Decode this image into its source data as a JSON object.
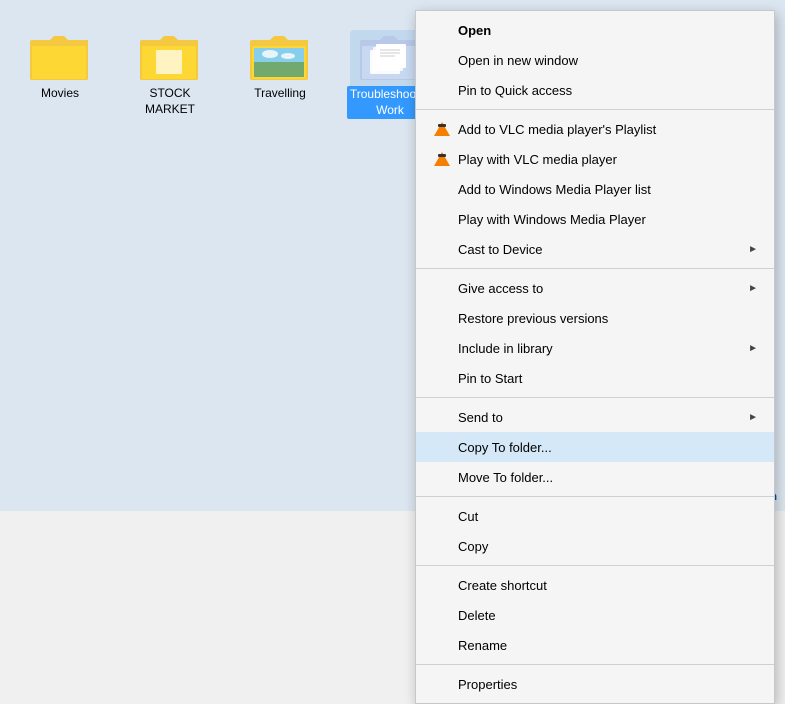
{
  "desktop": {
    "background": "#dce6f0"
  },
  "folders": [
    {
      "id": "movies",
      "label": "Movies",
      "selected": false
    },
    {
      "id": "stock-market",
      "label": "STOCK MARKET",
      "selected": false
    },
    {
      "id": "travelling",
      "label": "Travelling",
      "selected": false
    },
    {
      "id": "troubleshooter-work",
      "label": "Troubleshooter Work",
      "selected": true
    }
  ],
  "context_menu": {
    "items": [
      {
        "id": "open",
        "label": "Open",
        "bold": true,
        "icon": "",
        "submenu": false,
        "separator_after": false
      },
      {
        "id": "open-new-window",
        "label": "Open in new window",
        "bold": false,
        "icon": "",
        "submenu": false,
        "separator_after": false
      },
      {
        "id": "pin-quick-access",
        "label": "Pin to Quick access",
        "bold": false,
        "icon": "",
        "submenu": false,
        "separator_after": false
      },
      {
        "id": "add-vlc-playlist",
        "label": "Add to VLC media player's Playlist",
        "bold": false,
        "icon": "vlc",
        "submenu": false,
        "separator_after": false
      },
      {
        "id": "play-vlc",
        "label": "Play with VLC media player",
        "bold": false,
        "icon": "vlc",
        "submenu": false,
        "separator_after": false
      },
      {
        "id": "add-wmp-list",
        "label": "Add to Windows Media Player list",
        "bold": false,
        "icon": "",
        "submenu": false,
        "separator_after": false
      },
      {
        "id": "play-wmp",
        "label": "Play with Windows Media Player",
        "bold": false,
        "icon": "",
        "submenu": false,
        "separator_after": false
      },
      {
        "id": "cast-device",
        "label": "Cast to Device",
        "bold": false,
        "icon": "",
        "submenu": true,
        "separator_after": true
      },
      {
        "id": "give-access",
        "label": "Give access to",
        "bold": false,
        "icon": "",
        "submenu": true,
        "separator_after": false
      },
      {
        "id": "restore-versions",
        "label": "Restore previous versions",
        "bold": false,
        "icon": "",
        "submenu": false,
        "separator_after": false
      },
      {
        "id": "include-library",
        "label": "Include in library",
        "bold": false,
        "icon": "",
        "submenu": true,
        "separator_after": false
      },
      {
        "id": "pin-start",
        "label": "Pin to Start",
        "bold": false,
        "icon": "",
        "submenu": false,
        "separator_after": true
      },
      {
        "id": "send-to",
        "label": "Send to",
        "bold": false,
        "icon": "",
        "submenu": true,
        "separator_after": false
      },
      {
        "id": "copy-to-folder",
        "label": "Copy To folder...",
        "bold": false,
        "icon": "",
        "submenu": false,
        "highlighted": true,
        "separator_after": false
      },
      {
        "id": "move-to-folder",
        "label": "Move To folder...",
        "bold": false,
        "icon": "",
        "submenu": false,
        "separator_after": true
      },
      {
        "id": "cut",
        "label": "Cut",
        "bold": false,
        "icon": "",
        "submenu": false,
        "separator_after": false
      },
      {
        "id": "copy",
        "label": "Copy",
        "bold": false,
        "icon": "",
        "submenu": false,
        "separator_after": true
      },
      {
        "id": "create-shortcut",
        "label": "Create shortcut",
        "bold": false,
        "icon": "",
        "submenu": false,
        "separator_after": false
      },
      {
        "id": "delete",
        "label": "Delete",
        "bold": false,
        "icon": "",
        "submenu": false,
        "separator_after": false
      },
      {
        "id": "rename",
        "label": "Rename",
        "bold": false,
        "icon": "",
        "submenu": false,
        "separator_after": true
      },
      {
        "id": "properties",
        "label": "Properties",
        "bold": false,
        "icon": "",
        "submenu": false,
        "separator_after": false
      }
    ]
  },
  "watermark": "wsxdn.com"
}
